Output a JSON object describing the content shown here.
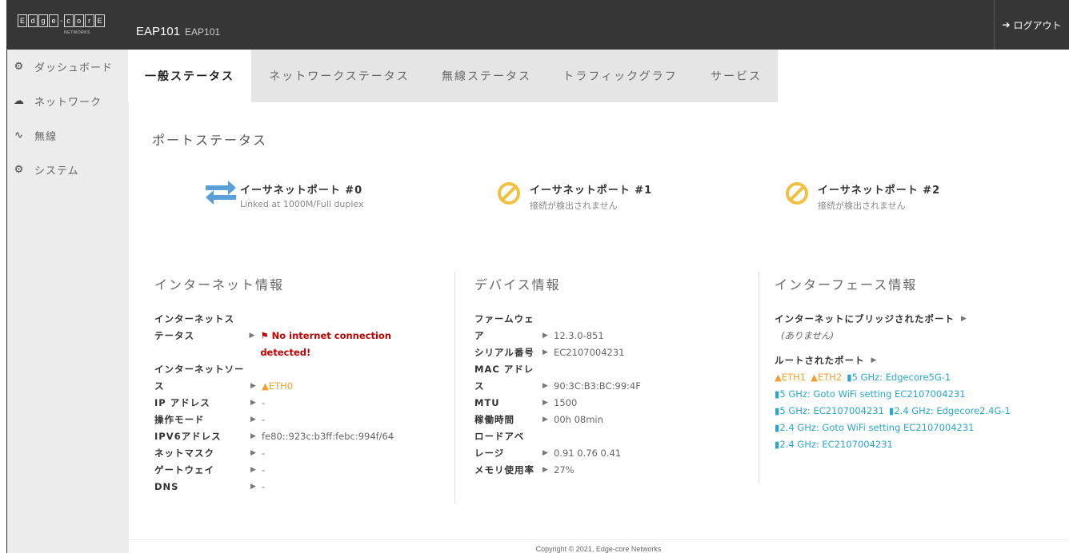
{
  "header": {
    "logo_text": "Edge-core",
    "logo_sub": "NETWORKS",
    "model": "EAP101",
    "model_sub": "EAP101",
    "logout_label": "ログアウト"
  },
  "sidebar": {
    "items": [
      {
        "label": "ダッシュボード",
        "icon": "dashboard-icon"
      },
      {
        "label": "ネットワーク",
        "icon": "cloud-icon"
      },
      {
        "label": "無線",
        "icon": "wifi-icon"
      },
      {
        "label": "システム",
        "icon": "gears-icon"
      }
    ]
  },
  "tabs": [
    {
      "label": "一般ステータス",
      "active": true
    },
    {
      "label": "ネットワークステータス"
    },
    {
      "label": "無線ステータス"
    },
    {
      "label": "トラフィックグラフ"
    },
    {
      "label": "サービス"
    }
  ],
  "port_status": {
    "title": "ポートステータス",
    "ports": [
      {
        "name": "イーサネットポート #0",
        "status": "Linked at 1000M/Full duplex"
      },
      {
        "name": "イーサネットポート #1",
        "status": "接続が検出されません"
      },
      {
        "name": "イーサネットポート #2",
        "status": "接続が検出されません"
      }
    ]
  },
  "internet_info": {
    "title": "インターネット情報",
    "status_label_1": "インターネットス",
    "status_label_2": "テータス",
    "status_value": "No internet connection detected!",
    "source_label_1": "インターネットソー",
    "source_label_2": "ス",
    "source_value": "ETH0",
    "ip_label": "IP アドレス",
    "ip_value": "-",
    "mode_label": "操作モード",
    "mode_value": "-",
    "ipv6_label": "IPV6アドレス",
    "ipv6_value": "fe80::923c:b3ff:febc:994f/64",
    "netmask_label": "ネットマスク",
    "netmask_value": "-",
    "gateway_label": "ゲートウェイ",
    "gateway_value": "-",
    "dns_label": "DNS",
    "dns_value": "-"
  },
  "device_info": {
    "title": "デバイス情報",
    "fw_label_1": "ファームウェ",
    "fw_label_2": "ア",
    "fw_value": "12.3.0-851",
    "serial_label": "シリアル番号",
    "serial_value": "EC2107004231",
    "mac_label_1": "MAC アドレ",
    "mac_label_2": "ス",
    "mac_value": "90:3C:B3:BC:99:4F",
    "mtu_label": "MTU",
    "mtu_value": "1500",
    "uptime_label": "稼働時間",
    "uptime_value": "00h 08min",
    "load_label_1": "ロードアベ",
    "load_label_2": "レージ",
    "load_value": "0.91 0.76 0.41",
    "mem_label": "メモリ使用率",
    "mem_value": "27%"
  },
  "interface_info": {
    "title": "インターフェース情報",
    "bridged_label": "インターネットにブリッジされたポート",
    "bridged_value": "(ありません)",
    "routed_label": "ルートされたポート",
    "routed_eth1": "ETH1",
    "routed_eth2": "ETH2",
    "routed_1": "5 GHz: Edgecore5G-1",
    "routed_2": "5 GHz: Goto WiFi setting EC2107004231",
    "routed_3": "5 GHz: EC2107004231",
    "routed_4": "2.4 GHz: Edgecore2.4G-1",
    "routed_5": "2.4 GHz: Goto WiFi setting EC2107004231",
    "routed_6": "2.4 GHz: EC2107004231"
  },
  "footer": {
    "copyright": "Copyright © 2021, Edge-core Networks"
  },
  "colors": {
    "topbar": "#363636",
    "sidebar": "#ececec",
    "accent_link": "#2ba6cb",
    "warning": "#f0c040",
    "error": "#c00000"
  }
}
